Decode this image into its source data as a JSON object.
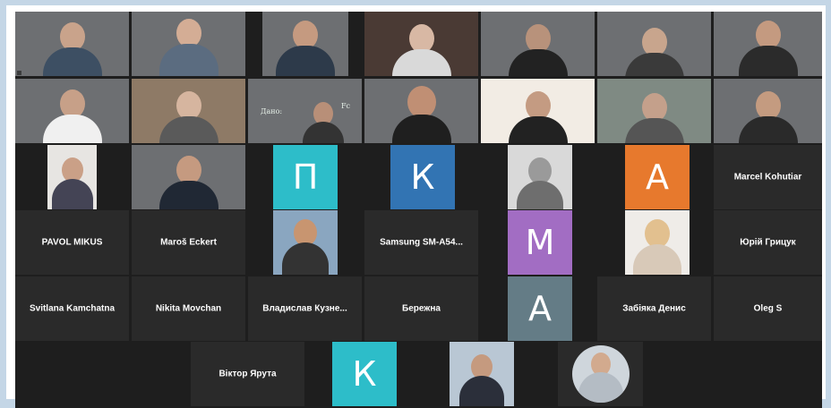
{
  "colors": {
    "avatar_cyan": "#2dbdc9",
    "avatar_blue": "#3274b3",
    "avatar_purple": "#a26dc3",
    "avatar_slate": "#647c86",
    "avatar_orange": "#e7792d",
    "grid_bg": "#1e1e1e",
    "frame_border": "#c4d6e6"
  },
  "avatars": {
    "p": "П",
    "k1": "К",
    "m": "М",
    "a1": "А",
    "a2": "А",
    "k2": "К"
  },
  "names": {
    "marcel": "Marcel Kohutiar",
    "pavol": "PAVOL MIKUS",
    "maros": "Maroš Eckert",
    "samsung": "Samsung SM-A54...",
    "yuriy": "Юрій Грицук",
    "svitlana": "Svitlana Kamchatna",
    "nikita": "Nikita Movchan",
    "vladyslav": "Владислав Кузне...",
    "berezhna": "Бережна",
    "zabiyaka": "Забіяка Денис",
    "oleg": "Oleg S",
    "viktor": "Віктор Ярута"
  },
  "board": {
    "line1": "Дано:",
    "line2": "Fc"
  }
}
